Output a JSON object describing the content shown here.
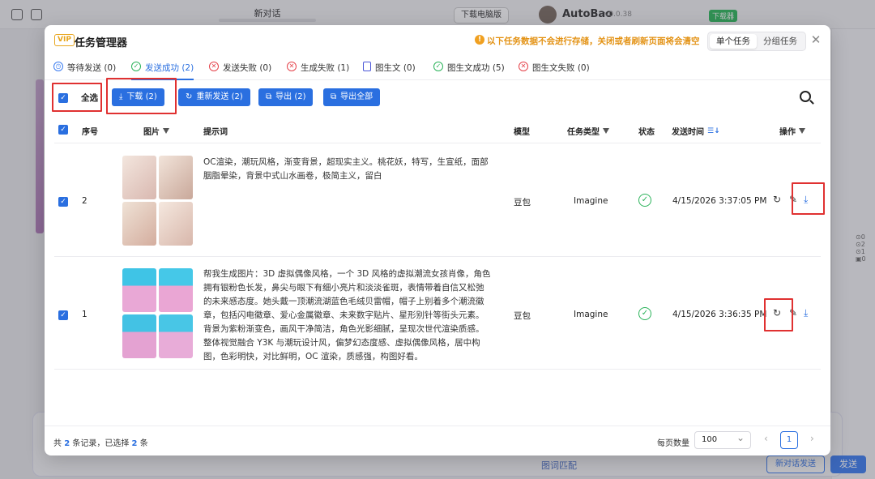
{
  "background": {
    "app_title": "新对话",
    "download_pc": "下载电脑版",
    "brand": "AutoBao",
    "version": "v0.0.38",
    "download_badge": "下载器",
    "send": "发送",
    "new_send": "新对话发送",
    "match": "图词匹配"
  },
  "modal": {
    "vip": "VIP",
    "title": "任务管理器",
    "warning": "以下任务数据不会进行存储，关闭或者刷新页面将会清空",
    "segments": [
      "单个任务",
      "分组任务"
    ],
    "tabs": [
      {
        "label": "等待发送 (0)",
        "icon": "clock-icon"
      },
      {
        "label": "发送成功 (2)",
        "icon": "check-circle-icon"
      },
      {
        "label": "发送失败 (0)",
        "icon": "x-circle-icon"
      },
      {
        "label": "生成失败 (1)",
        "icon": "x-circle-icon"
      },
      {
        "label": "图生文 (0)",
        "icon": "document-icon"
      },
      {
        "label": "图生文成功 (5)",
        "icon": "check-circle-icon"
      },
      {
        "label": "图生文失败 (0)",
        "icon": "x-circle-icon"
      }
    ],
    "toolbar": {
      "select_all": "全选",
      "download": "下载 (2)",
      "resend": "重新发送 (2)",
      "export": "导出 (2)",
      "export_all": "导出全部"
    },
    "columns": {
      "index": "序号",
      "image": "图片",
      "prompt": "提示词",
      "model": "模型",
      "task_type": "任务类型",
      "status": "状态",
      "send_time": "发送时间",
      "actions": "操作"
    },
    "rows": [
      {
        "index": "2",
        "prompt": "OC渲染，潮玩风格，渐变背景，超现实主义。桃花妖，特写，生宣纸，面部胭脂晕染，背景中式山水画卷，极简主义，留白",
        "model": "豆包",
        "task_type": "Imagine",
        "send_time": "4/15/2026 3:37:05 PM"
      },
      {
        "index": "1",
        "prompt": "帮我生成图片：3D 虚拟偶像风格，一个 3D 风格的虚拟潮流女孩肖像，角色拥有银粉色长发，鼻尖与眼下有细小亮片和淡淡雀斑，表情带着自信又松弛的未来感态度。她头戴一顶潮流湖蓝色毛绒贝雷帽，帽子上别着多个潮流徽章，包括闪电徽章、爱心金属徽章、未来数字贴片、星形别针等街头元素。背景为紫粉渐变色，画风干净简洁，角色光影细腻，呈现次世代渲染质感。整体视觉融合 Y3K 与潮玩设计风，偏梦幻态度感、虚拟偶像风格，居中构图，色彩明快，对比鲜明，OC 渲染，质感强，构图好看。",
        "model": "豆包",
        "task_type": "Imagine",
        "send_time": "4/15/2026 3:36:35 PM"
      }
    ],
    "footer": {
      "summary_prefix": "共",
      "total": "2",
      "summary_mid": "条记录，已选择",
      "selected": "2",
      "summary_suffix": "条",
      "page_size_label": "每页数量",
      "page_size": "100",
      "page": "1"
    }
  },
  "colors": {
    "accent": "#2a6fe0",
    "warning": "#e39214",
    "highlight": "#e03131",
    "success": "#2bb35a"
  }
}
